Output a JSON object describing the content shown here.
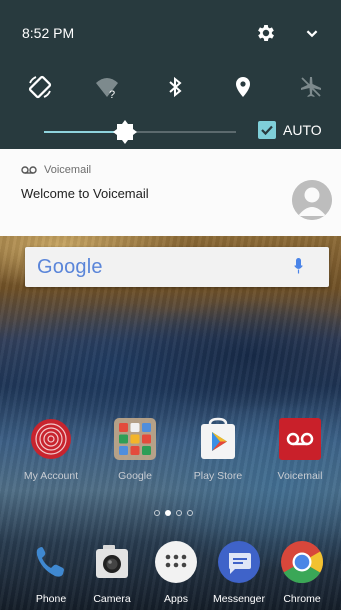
{
  "status": {
    "time": "8:52 PM"
  },
  "quick_settings": {
    "tiles": [
      {
        "name": "auto-rotate-icon"
      },
      {
        "name": "wifi-icon"
      },
      {
        "name": "bluetooth-icon"
      },
      {
        "name": "location-icon"
      },
      {
        "name": "airplane-mode-icon"
      }
    ],
    "brightness_level_percent": 42,
    "auto_label": "AUTO",
    "auto_checked": true,
    "colors": {
      "background": "#283a3e",
      "accent": "#8fd3dd"
    }
  },
  "notification": {
    "app_name": "Voicemail",
    "title": "Welcome to Voicemail",
    "icon": "voicemail-icon"
  },
  "home": {
    "search_logo": "Google",
    "apps_row": [
      {
        "label": "My Account",
        "icon": "my-account-icon"
      },
      {
        "label": "Google",
        "icon": "google-folder-icon"
      },
      {
        "label": "Play Store",
        "icon": "play-store-icon"
      },
      {
        "label": "Voicemail",
        "icon": "voicemail-app-icon"
      }
    ],
    "page_indicator": {
      "pages": 4,
      "current": 2
    },
    "dock": [
      {
        "label": "Phone",
        "icon": "phone-icon"
      },
      {
        "label": "Camera",
        "icon": "camera-icon"
      },
      {
        "label": "Apps",
        "icon": "apps-icon"
      },
      {
        "label": "Messenger",
        "icon": "messenger-icon"
      },
      {
        "label": "Chrome",
        "icon": "chrome-icon"
      }
    ]
  }
}
